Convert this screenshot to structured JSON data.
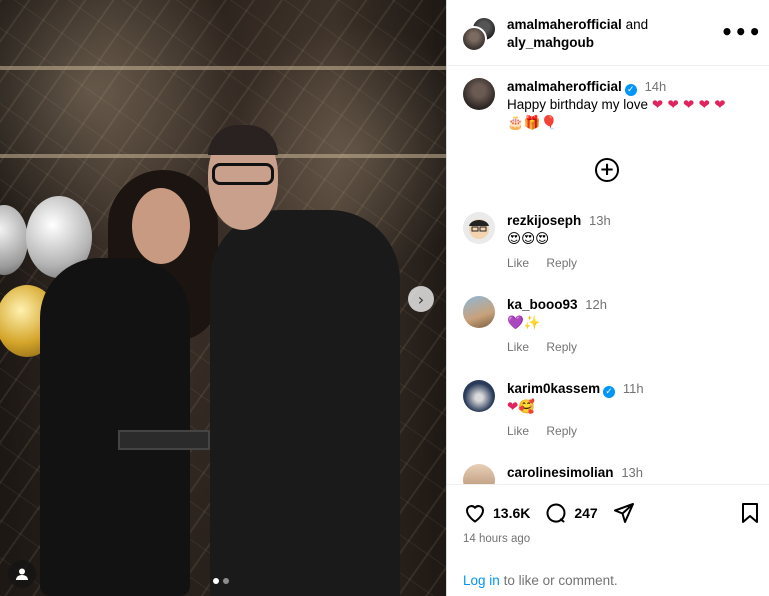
{
  "post": {
    "authors": [
      "amalmaherofficial",
      "aly_mahgoub"
    ],
    "and_word": "and",
    "more_label": "•••",
    "next_label": "›"
  },
  "caption": {
    "username": "amalmaherofficial",
    "time": "14h",
    "text": "Happy birthday my love",
    "emojis_line1": "❤ ❤ ❤ ❤ ❤",
    "emojis_line2": "🎂🎁🎈"
  },
  "load_more_label": "+",
  "comments": [
    {
      "username": "rezkijoseph",
      "time": "13h",
      "text": "😍😍😍",
      "like": "Like",
      "reply": "Reply"
    },
    {
      "username": "ka_booo93",
      "time": "12h",
      "text": "💜✨",
      "like": "Like",
      "reply": "Reply"
    },
    {
      "username": "karim0kassem",
      "time": "11h",
      "text": "❤🥰",
      "like": "Like",
      "reply": "Reply"
    },
    {
      "username": "carolinesimolian",
      "time": "13h",
      "text": "❤❤❤❤"
    }
  ],
  "stats": {
    "likes": "13.6K",
    "comments": "247"
  },
  "posted_ago": "14 hours ago",
  "login": {
    "link": "Log in",
    "rest": "to like or comment."
  },
  "colors": {
    "accent": "#0095f6",
    "heart": "#e0245e",
    "muted": "#737373"
  }
}
